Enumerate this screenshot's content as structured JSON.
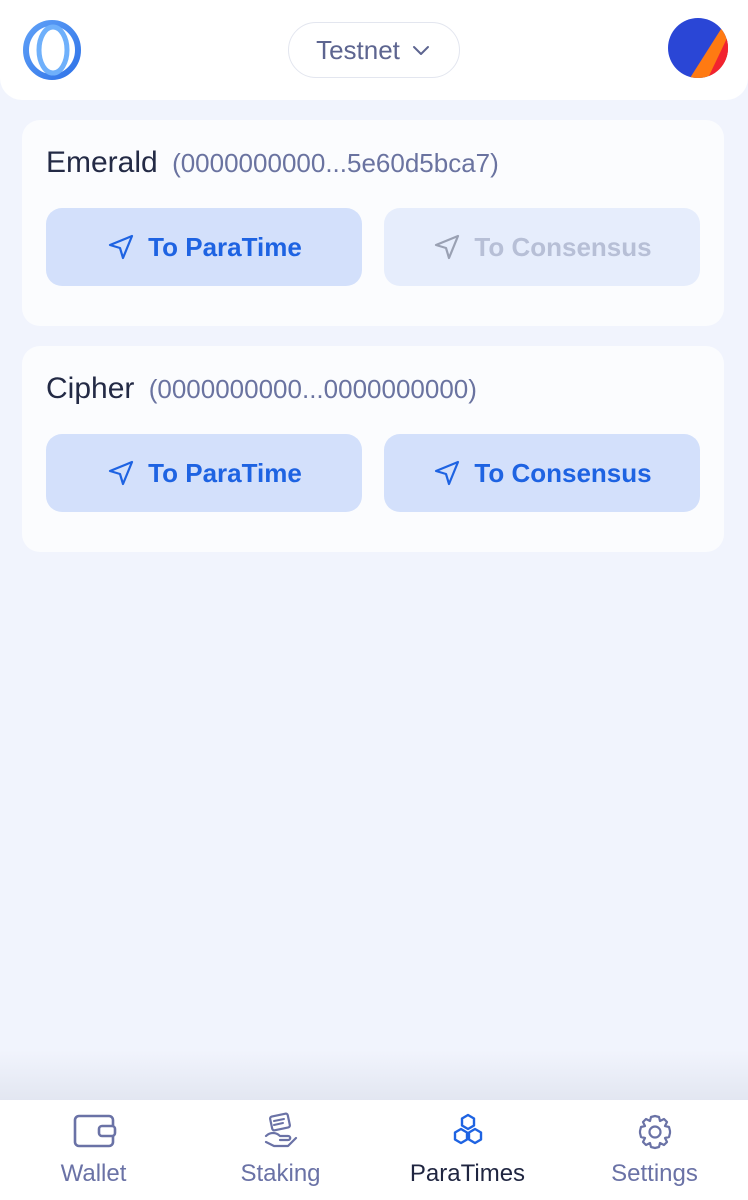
{
  "header": {
    "network_label": "Testnet",
    "logo_icon": "oasis-logo-icon",
    "avatar_icon": "account-avatar-icon"
  },
  "paratimes": [
    {
      "name": "Emerald",
      "address": "(0000000000...5e60d5bca7)",
      "to_paratime_label": "To ParaTime",
      "to_consensus_label": "To Consensus",
      "to_consensus_disabled": true
    },
    {
      "name": "Cipher",
      "address": "(0000000000...0000000000)",
      "to_paratime_label": "To ParaTime",
      "to_consensus_label": "To Consensus",
      "to_consensus_disabled": false
    }
  ],
  "nav": {
    "items": [
      {
        "label": "Wallet",
        "icon": "wallet-icon"
      },
      {
        "label": "Staking",
        "icon": "staking-icon"
      },
      {
        "label": "ParaTimes",
        "icon": "paratimes-icon",
        "active": true
      },
      {
        "label": "Settings",
        "icon": "gear-icon"
      }
    ]
  },
  "colors": {
    "accent": "#1e63e2",
    "button_bg": "#d3e0fb",
    "page_bg": "#f1f4fd"
  }
}
